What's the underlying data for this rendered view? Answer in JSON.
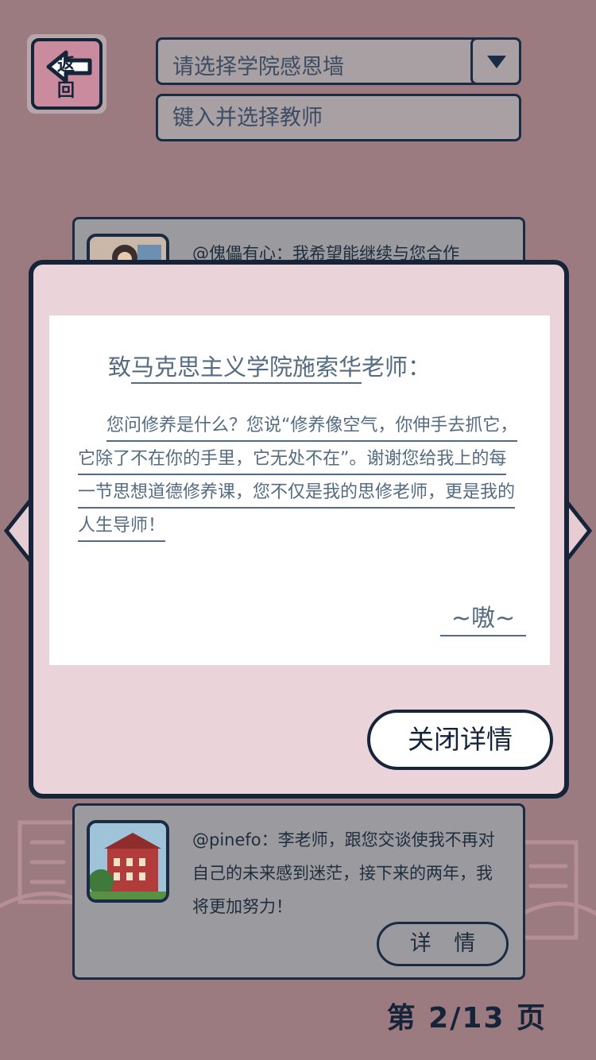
{
  "header": {
    "back_label": "返 回",
    "college_select": "请选择学院感恩墙",
    "teacher_placeholder": "键入并选择教师"
  },
  "cards": [
    {
      "author": "@傀儡有心",
      "message": "@傀儡有心：我希望能继续与您合作"
    },
    {
      "author": "@pinefo",
      "message": "@pinefo：李老师，跟您交谈使我不再对自己的未来感到迷茫，接下来的两年，我将更加努力！",
      "detail_label": "详 情"
    }
  ],
  "modal": {
    "greeting_prefix": "致",
    "college": "马克思主义学院",
    "teacher": "施索华",
    "greeting_suffix": "老师：",
    "body": "您问修养是什么？您说“修养像空气，你伸手去抓它，它除了不在你的手里，它无处不在”。谢谢您给我上的每一节思想道德修养课，您不仅是我的思修老师，更是我的人生导师！",
    "signature": "~嗷~",
    "close_label": "关闭详情"
  },
  "pagination": {
    "label": "第 2/13 页"
  },
  "colors": {
    "background": "#9c7b80",
    "modal_bg": "#ead4da",
    "ink": "#16243a",
    "letter_text": "#546b82",
    "back_button": "#c98b9d"
  }
}
